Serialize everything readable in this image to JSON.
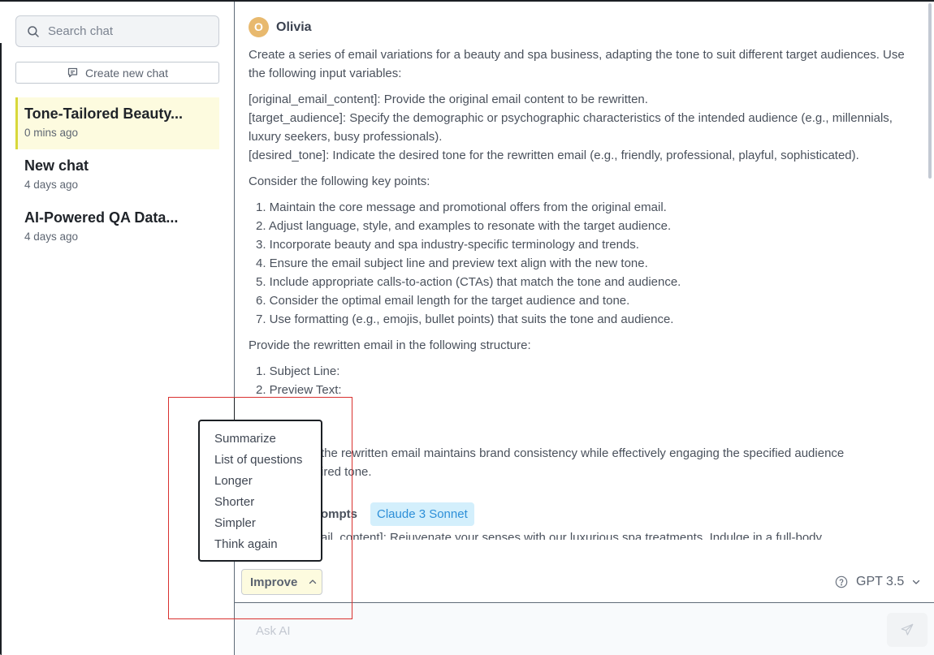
{
  "sidebar": {
    "search_placeholder": "Search chat",
    "new_chat_label": "Create new chat",
    "chats": [
      {
        "title": "Tone-Tailored Beauty...",
        "time": "0 mins ago",
        "active": true
      },
      {
        "title": "New chat",
        "time": "4 days ago",
        "active": false
      },
      {
        "title": "AI-Powered QA Data...",
        "time": "4 days ago",
        "active": false
      }
    ]
  },
  "message": {
    "avatar_initial": "O",
    "user_name": "Olivia",
    "intro": "Create a series of email variations for a beauty and spa business, adapting the tone to suit different target audiences. Use the following input variables:",
    "variables": [
      "[original_email_content]: Provide the original email content to be rewritten.",
      "[target_audience]: Specify the demographic or psychographic characteristics of the intended audience (e.g., millennials, luxury seekers, busy professionals).",
      "[desired_tone]: Indicate the desired tone for the rewritten email (e.g., friendly, professional, playful, sophisticated)."
    ],
    "key_points_heading": "Consider the following key points:",
    "key_points": [
      "1. Maintain the core message and promotional offers from the original email.",
      "2. Adjust language, style, and examples to resonate with the target audience.",
      "3. Incorporate beauty and spa industry-specific terminology and trends.",
      "4. Ensure the email subject line and preview text align with the new tone.",
      "5. Include appropriate calls-to-action (CTAs) that match the tone and audience.",
      "6. Consider the optimal email length for the target audience and tone.",
      "7. Use formatting (e.g., emojis, bullet points) that suits the tone and audience."
    ],
    "structure_heading": "Provide the rewritten email in the following structure:",
    "structure": [
      "1. Subject Line:",
      "2. Preview Text:"
    ],
    "closing_line1": "the rewritten email maintains brand consistency while effectively engaging the specified audience",
    "closing_line2": "ired tone.",
    "models_heading_fragment": "ompts",
    "model_badge": "Claude 3 Sonnet",
    "cut_line": "ail_content]: Rejuvenate your senses with our luxurious spa treatments. Indulge in a full-body"
  },
  "toolbar": {
    "improve_label": "Improve",
    "model_label": "GPT 3.5"
  },
  "improve_menu": {
    "items": [
      "Summarize",
      "List of questions",
      "Longer",
      "Shorter",
      "Simpler",
      "Think again"
    ]
  },
  "input": {
    "placeholder": "Ask AI"
  },
  "colors": {
    "active_chat_bg": "#fdfbdf",
    "active_chat_border": "#d8d83a",
    "avatar": "#e8b96e",
    "badge_bg": "#d3effc",
    "badge_text": "#2d8fd8",
    "annotation": "#d9312f"
  }
}
